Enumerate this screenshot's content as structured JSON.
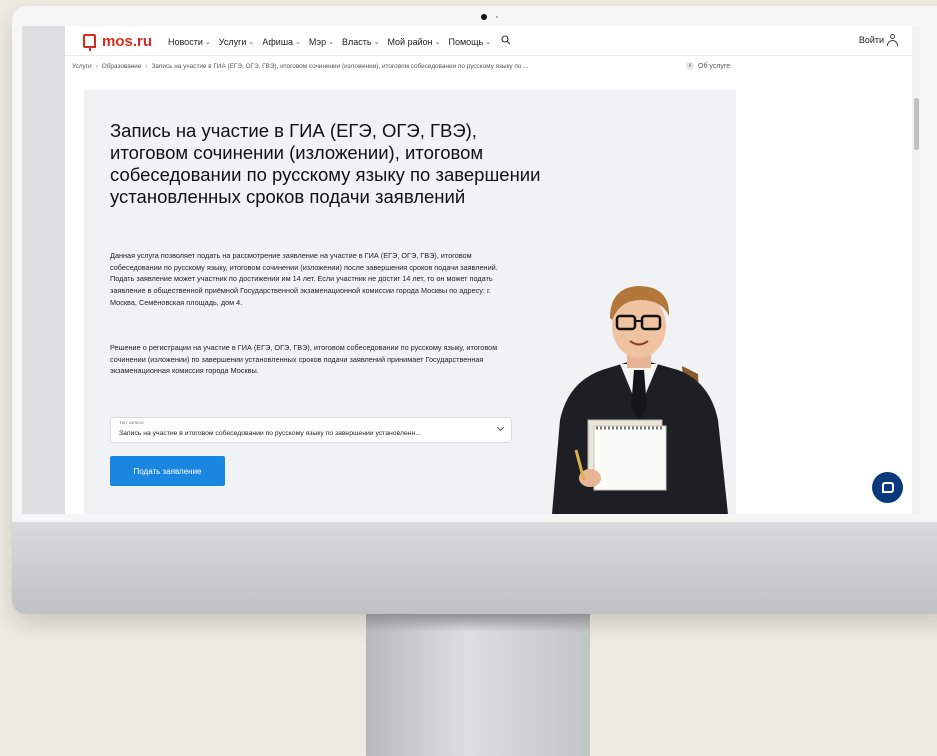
{
  "header": {
    "logo_text": "mos.ru",
    "nav": [
      {
        "label": "Новости"
      },
      {
        "label": "Услуги"
      },
      {
        "label": "Афиша"
      },
      {
        "label": "Мэр"
      },
      {
        "label": "Власть"
      },
      {
        "label": "Мой район"
      },
      {
        "label": "Помощь"
      }
    ],
    "login_label": "Войти"
  },
  "breadcrumbs": [
    "Услуги",
    "Образование",
    "Запись на участие в ГИА (ЕГЭ, ОГЭ, ГВЭ), итоговом сочинении (изложении), итоговом собеседовании по русскому языку по ..."
  ],
  "about_label": "Об услуге",
  "main": {
    "title": "Запись на участие в ГИА (ЕГЭ, ОГЭ, ГВЭ), итоговом сочинении (изложении), итоговом собеседовании по русскому языку по завершении установленных сроков подачи заявлений",
    "paragraph_1": "Данная услуга позволяет подать на рассмотрение заявление на участие в ГИА (ЕГЭ, ОГЭ, ГВЭ), итоговом собеседовании по русскому языку, итоговом сочинении (изложении) после завершения сроков подачи заявлений. Подать заявление может участник по достижении им 14 лет. Если участник не достиг 14 лет, то он может подать заявление в общественной приёмной Государственной экзаменационной комиссии города Москвы по адресу: г. Москва, Семёновская площадь, дом 4.",
    "paragraph_2": "Решение о регистрации на участие в ГИА (ЕГЭ, ОГЭ, ГВЭ), итоговом собеседовании по русскому языку, итоговом сочинении (изложении) по завершении установленных сроков подачи заявлений принимает Государственная экзаменационная комиссия города Москвы.",
    "select": {
      "label": "Тип записи",
      "value": "Запись на участие в итоговом собеседовании по русскому языку по завершении установленн..."
    },
    "submit_label": "Подать заявление"
  },
  "colors": {
    "brand_red": "#d52b1e",
    "button_blue": "#1b86e0",
    "chat_blue": "#0a3a7c",
    "card_bg": "#f1f2f4"
  },
  "icons": [
    "logo-icon",
    "chevron-down-icon",
    "search-icon",
    "user-icon",
    "info-icon",
    "chat-icon"
  ]
}
